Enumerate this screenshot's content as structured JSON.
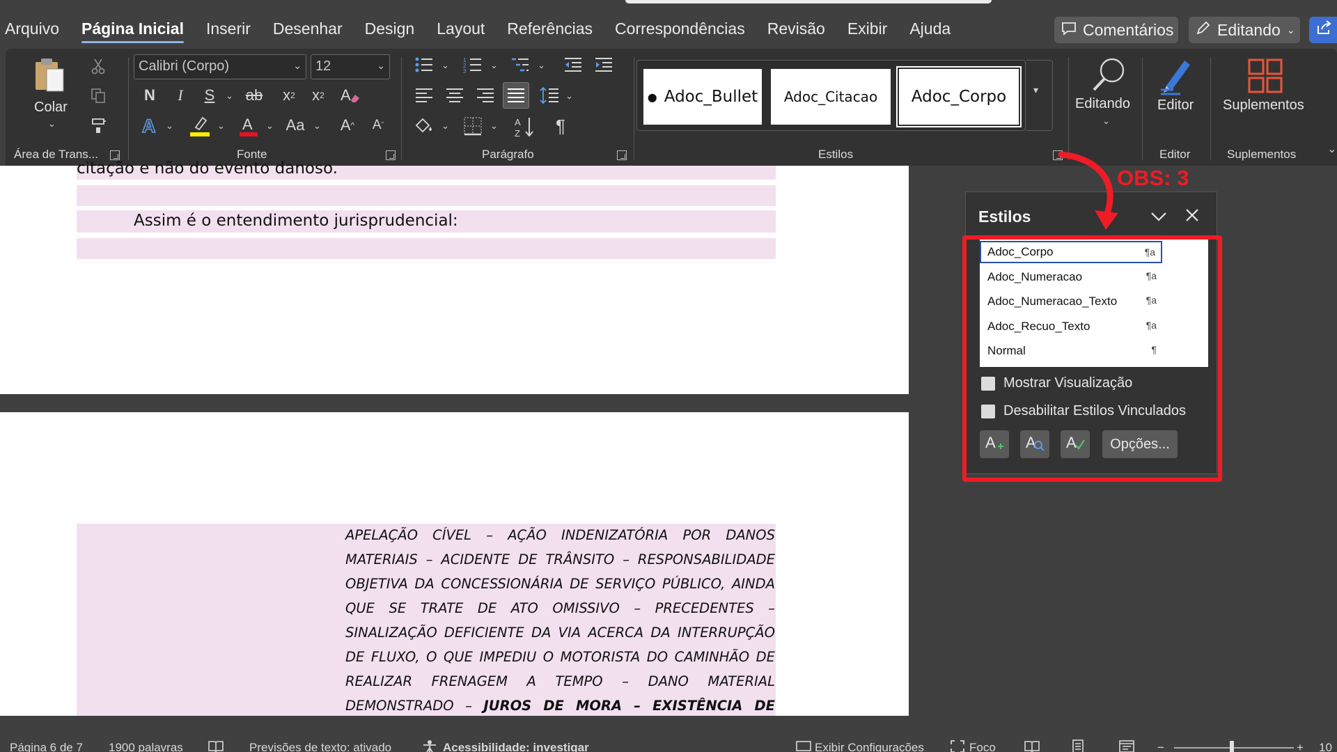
{
  "menu": {
    "tabs": [
      "Arquivo",
      "Página Inicial",
      "Inserir",
      "Desenhar",
      "Design",
      "Layout",
      "Referências",
      "Correspondências",
      "Revisão",
      "Exibir",
      "Ajuda"
    ],
    "active_tab": "Página Inicial",
    "comments_label": "Comentários",
    "editing_label": "Editando"
  },
  "ribbon": {
    "clipboard": {
      "paste_label": "Colar",
      "group_label": "Área de Trans..."
    },
    "font": {
      "font_name": "Calibri (Corpo)",
      "font_size": "12",
      "bold_glyph": "N",
      "italic_glyph": "I",
      "underline_glyph": "S",
      "strike_glyph": "ab",
      "case_glyph": "Aa",
      "group_label": "Fonte"
    },
    "paragraph": {
      "group_label": "Parágrafo"
    },
    "styles": {
      "cards": [
        "Adoc_Bullet",
        "Adoc_Citacao",
        "Adoc_Corpo"
      ],
      "group_label": "Estilos"
    },
    "editing": {
      "label": "Editando"
    },
    "editor": {
      "label": "Editor",
      "group_label": "Editor"
    },
    "addins": {
      "label": "Suplementos",
      "group_label": "Suplementos"
    }
  },
  "document": {
    "page1_cutoff": "citação e não do evento danoso.",
    "page1_line": "Assim é o entendimento jurisprudencial:",
    "quote_lines": [
      "APELAÇÃO CÍVEL – AÇÃO INDENIZATÓRIA POR DANOS",
      "MATERIAIS – ACIDENTE DE TRÂNSITO – RESPONSABILIDADE",
      "OBJETIVA DA CONCESSIONÁRIA DE SERVIÇO PÚBLICO, AINDA",
      "QUE SE TRATE DE ATO OMISSIVO – PRECEDENTES –",
      "SINALIZAÇÃO DEFICIENTE DA VIA ACERCA DA INTERRUPÇÃO",
      "DE FLUXO, O QUE IMPEDIU O MOTORISTA DO CAMINHÃO DE",
      "REALIZAR FRENAGEM A TEMPO – DANO MATERIAL"
    ],
    "quote_last_plain": "DEMONSTRADO –",
    "quote_last_bold": "JUROS DE MORA – EXISTÊNCIA DE"
  },
  "styles_pane": {
    "title": "Estilos",
    "items": [
      {
        "name": "Adoc_Corpo",
        "marker": "¶a",
        "selected": true
      },
      {
        "name": "Adoc_Numeracao",
        "marker": "¶a",
        "selected": false
      },
      {
        "name": "Adoc_Numeracao_Texto",
        "marker": "¶a",
        "selected": false
      },
      {
        "name": "Adoc_Recuo_Texto",
        "marker": "¶a",
        "selected": false
      },
      {
        "name": "Normal",
        "marker": "¶",
        "selected": false
      }
    ],
    "show_preview_label": "Mostrar Visualização",
    "show_preview_checked": false,
    "disable_linked_label": "Desabilitar Estilos Vinculados",
    "disable_linked_checked": false,
    "options_label": "Opções..."
  },
  "annotation": {
    "text": "OBS: 3",
    "color": "#ee1c25"
  },
  "statusbar": {
    "page": "Página 6 de 7",
    "words": "1900 palavras",
    "predictions": "Previsões de texto: ativado",
    "accessibility": "Acessibilidade: investigar",
    "display_settings": "Exibir Configurações",
    "focus": "Foco",
    "zoom_minus": "−",
    "zoom_plus": "+",
    "zoom_value": "10"
  },
  "colors": {
    "highlight": "#f2e0ef",
    "accent_red": "#ee1c25",
    "font_color_underline": "#e81123",
    "highlighter_yellow": "#ffef00"
  }
}
